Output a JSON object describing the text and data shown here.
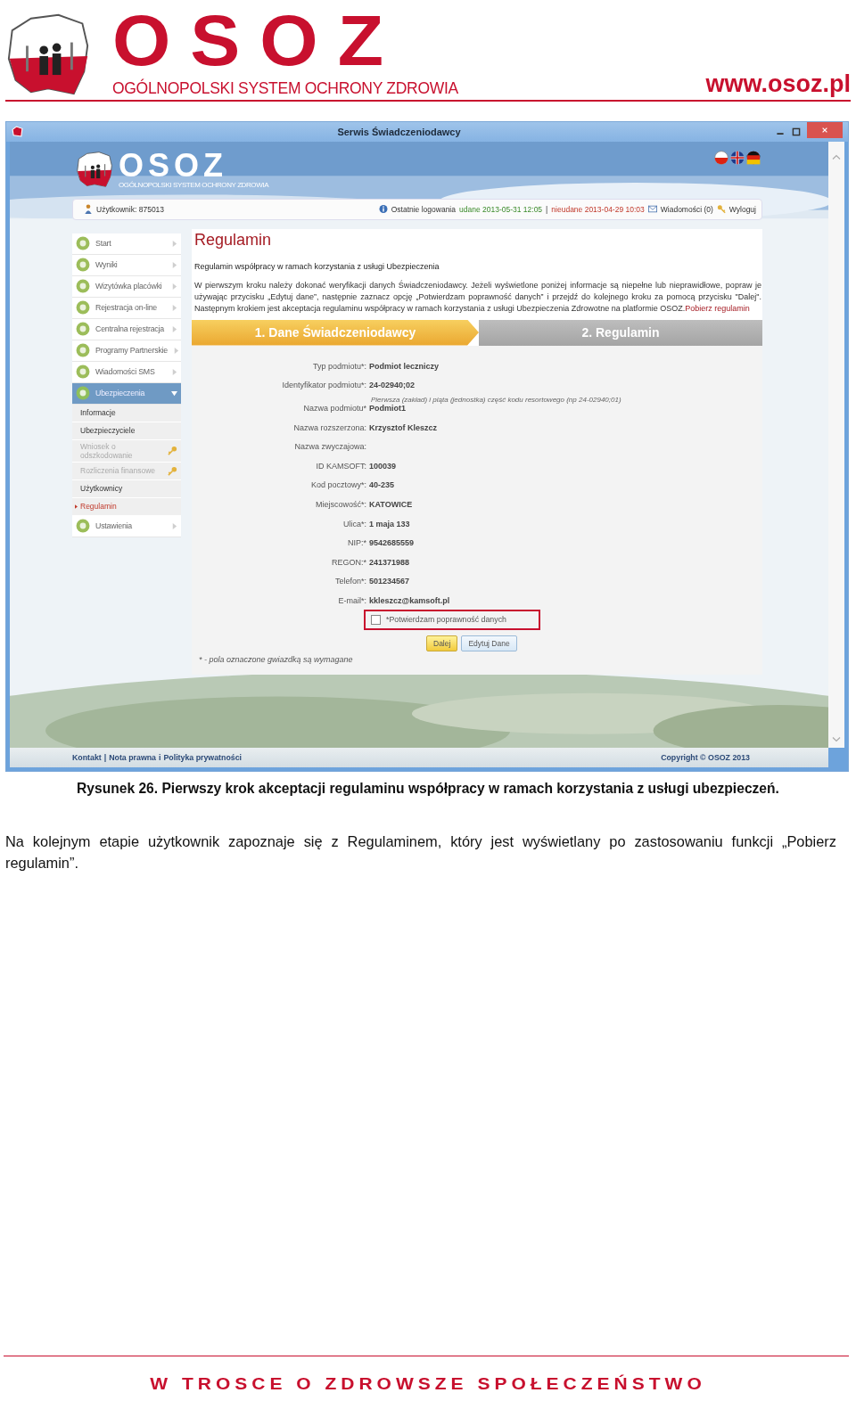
{
  "header": {
    "logo_title": "OSOZ",
    "logo_subtitle": "OGÓLNOPOLSKI SYSTEM OCHRONY ZDROWIA",
    "url": "www.osoz.pl"
  },
  "window": {
    "title": "Serwis Świadczeniodawcy"
  },
  "app": {
    "logo_title": "OSOZ",
    "logo_subtitle": "OGÓLNOPOLSKI SYSTEM OCHRONY ZDROWIA",
    "user": "Użytkownik: 875013",
    "last_login_label": "Ostatnie logowania",
    "login_ok": "udane 2013-05-31 12:05",
    "login_sep": "|",
    "login_failed": "nieudane 2013-04-29 10:03",
    "messages": "Wiadomości (0)",
    "logout": "Wyloguj"
  },
  "sidebar": {
    "items": [
      {
        "label": "Start",
        "selected": false,
        "expanded": false
      },
      {
        "label": "Wyniki",
        "selected": false,
        "expanded": false
      },
      {
        "label": "Wizytówka placówki",
        "selected": false,
        "expanded": false
      },
      {
        "label": "Rejestracja on-line",
        "selected": false,
        "expanded": false
      },
      {
        "label": "Centralna rejestracja",
        "selected": false,
        "expanded": false
      },
      {
        "label": "Programy Partnerskie",
        "selected": false,
        "expanded": false
      },
      {
        "label": "Wiadomości SMS",
        "selected": false,
        "expanded": false
      },
      {
        "label": "Ubezpieczenia",
        "selected": true,
        "expanded": true,
        "children": [
          {
            "label": "Informacje",
            "selected": false,
            "disabled": false
          },
          {
            "label": "Ubezpieczyciele",
            "selected": false,
            "disabled": false
          },
          {
            "label": "Wniosek o odszkodowanie",
            "selected": false,
            "disabled": true
          },
          {
            "label": "Rozliczenia finansowe",
            "selected": false,
            "disabled": true
          },
          {
            "label": "Użytkownicy",
            "selected": false,
            "disabled": false
          },
          {
            "label": "Regulamin",
            "selected": true,
            "disabled": false
          }
        ]
      },
      {
        "label": "Ustawienia",
        "selected": false,
        "expanded": false
      }
    ]
  },
  "page": {
    "title": "Regulamin",
    "subtitle": "Regulamin współpracy w ramach korzystania z usługi Ubezpieczenia",
    "intro": "W pierwszym kroku należy dokonać weryfikacji danych Świadczeniodawcy. Jeżeli wyświetlone poniżej informacje są niepełne lub nieprawidłowe, popraw je używając przycisku „Edytuj dane”, następnie zaznacz opcję „Potwierdzam poprawność danych” i przejdź do kolejnego kroku za pomocą przycisku \"Dalej\". Następnym krokiem jest akceptacja regulaminu współpracy w ramach korzystania z usługi Ubezpieczenia Zdrowotne na platformie OSOZ.",
    "intro_link": "Pobierz regulamin",
    "steps": [
      {
        "label": "1. Dane Świadczeniodawcy",
        "selected": true
      },
      {
        "label": "2. Regulamin",
        "selected": false
      }
    ],
    "fields": [
      {
        "label": "Typ podmiotu*:",
        "value": "Podmiot leczniczy"
      },
      {
        "label": "Identyfikator podmiotu*:",
        "value": "24-02940;02",
        "hint": "Pierwsza (zakład) i piąta (jednostka) część kodu resortowego (np 24-02940;01)"
      },
      {
        "label": "Nazwa podmiotu*",
        "value": "Podmiot1"
      },
      {
        "label": "Nazwa rozszerzona:",
        "value": "Krzysztof Kleszcz"
      },
      {
        "label": "Nazwa zwyczajowa:"
      },
      {
        "label": "ID KAMSOFT:",
        "value": "100039"
      },
      {
        "label": "Kod pocztowy*:",
        "value": "40-235"
      },
      {
        "label": "Miejscowość*:",
        "value": "KATOWICE"
      },
      {
        "label": "Ulica*:",
        "value": "1 maja 133"
      },
      {
        "label": "NIP:*",
        "value": "9542685559"
      },
      {
        "label": "REGON:*",
        "value": "241371988"
      },
      {
        "label": "Telefon*:",
        "value": "501234567"
      },
      {
        "label": "E-mail*:",
        "value": "kkleszcz@kamsoft.pl"
      }
    ],
    "confirm": {
      "label": "*Potwierdzam poprawność danych",
      "checked": false
    },
    "buttons": [
      {
        "label": "Dalej",
        "kind": "primary"
      },
      {
        "label": "Edytuj Dane",
        "kind": "secondary"
      }
    ],
    "required_note": "* - pola oznaczone gwiazdką są wymagane"
  },
  "footer": {
    "links": [
      "Kontakt",
      "Nota prawna",
      "Polityka prywatności"
    ],
    "separators": [
      "|",
      "i"
    ],
    "copyright": "Copyright © OSOZ 2013"
  },
  "caption": "Rysunek 26. Pierwszy krok akceptacji regulaminu współpracy w ramach korzystania z usługi ubezpieczeń.",
  "paragraph": "Na kolejnym etapie użytkownik zapoznaje się z Regulaminem, który jest wyświetlany po zastosowaniu funkcji „Pobierz regulamin”.",
  "slogan": "W TROSCE O ZDROWSZE SPOŁECZEŃSTWO"
}
